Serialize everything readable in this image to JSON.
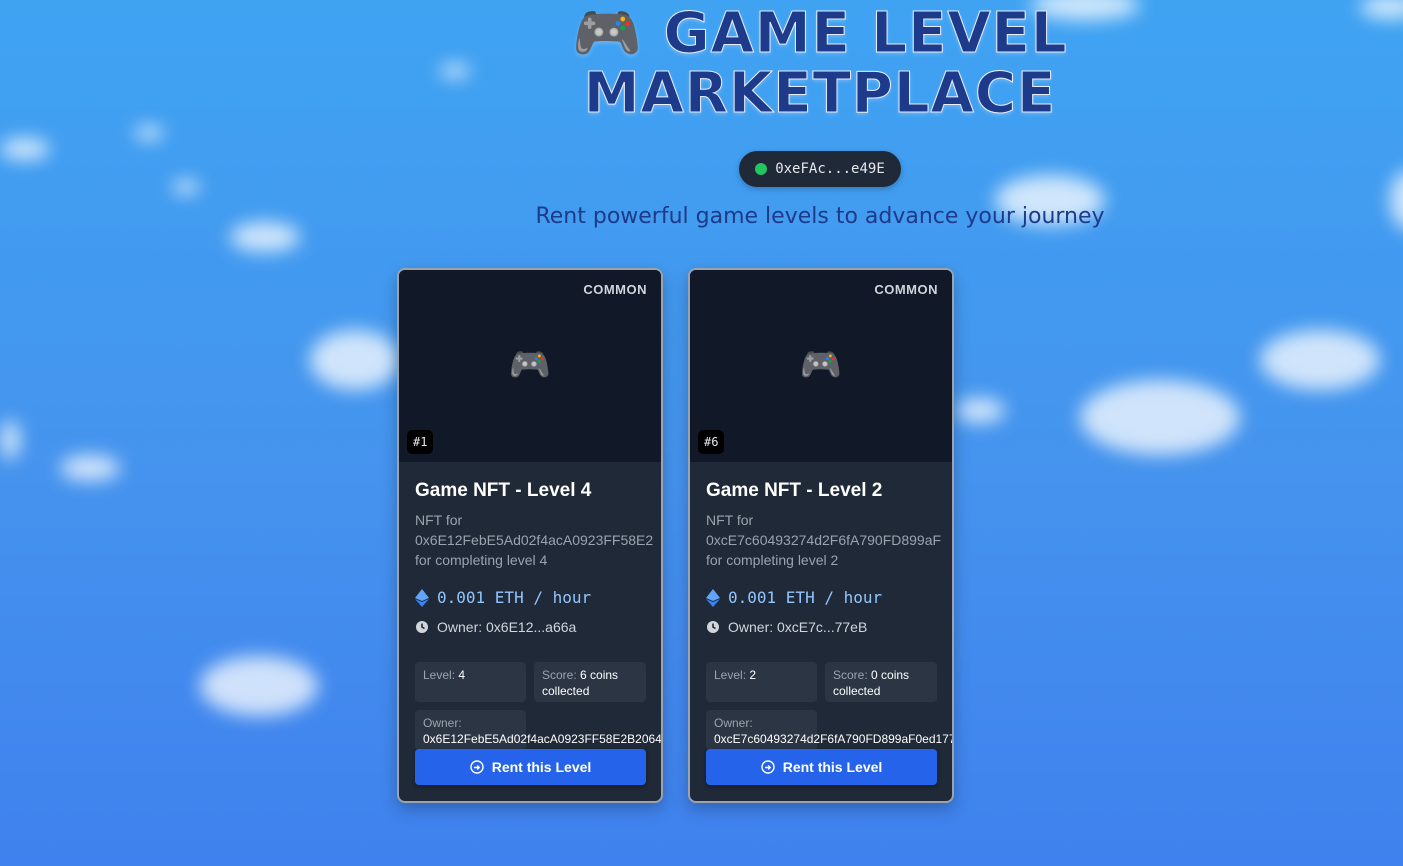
{
  "header": {
    "title_line1": "🎮 GAME LEVEL",
    "title_line2": "MARKETPLACE",
    "wallet_address": "0xeFAc...e49E",
    "wallet_status_color": "#22c55e",
    "subtitle": "Rent powerful game levels to advance your journey"
  },
  "colors": {
    "accent": "#2563eb",
    "card_bg": "#1f2937",
    "price_text": "#93c5fd",
    "title": "#1e3a8a"
  },
  "cards": [
    {
      "rarity": "COMMON",
      "image_icon": "gamepad-icon",
      "image_glyph": "🎮",
      "token_id": "#1",
      "title": "Game NFT - Level 4",
      "desc_line1": "NFT for",
      "desc_line2": "0x6E12FebE5Ad02f4acA0923FF58E2",
      "desc_line3": "for completing level 4",
      "price": "0.001 ETH / hour",
      "owner_short": "Owner: 0x6E12...a66a",
      "attr_level_key": "Level:",
      "attr_level_val": "4",
      "attr_score_key": "Score:",
      "attr_score_val": "6 coins collected",
      "attr_owner_key": "Owner:",
      "attr_owner_val": "0x6E12FebE5Ad02f4acA0923FF58E2B2064",
      "button_label": "Rent this Level"
    },
    {
      "rarity": "COMMON",
      "image_icon": "gamepad-icon",
      "image_glyph": "🎮",
      "token_id": "#6",
      "title": "Game NFT - Level 2",
      "desc_line1": "NFT for",
      "desc_line2": "0xcE7c60493274d2F6fA790FD899aF",
      "desc_line3": "for completing level 2",
      "price": "0.001 ETH / hour",
      "owner_short": "Owner: 0xcE7c...77eB",
      "attr_level_key": "Level:",
      "attr_level_val": "2",
      "attr_score_key": "Score:",
      "attr_score_val": "0 coins collected",
      "attr_owner_key": "Owner:",
      "attr_owner_val": "0xcE7c60493274d2F6fA790FD899aF0ed177",
      "button_label": "Rent this Level"
    }
  ]
}
